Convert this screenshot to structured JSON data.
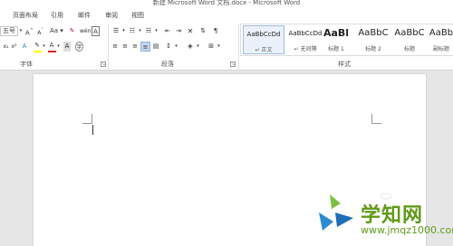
{
  "window": {
    "title": "新建 Microsoft Word 文档.docx - Microsoft Word"
  },
  "tabs": [
    "页面布局",
    "引用",
    "邮件",
    "审阅",
    "视图"
  ],
  "font_group": {
    "label": "字体",
    "font_size": "五号",
    "font_size_icon": "font-size-dropdown",
    "buttons": [
      "A",
      "A",
      "Aa",
      "A",
      "A"
    ]
  },
  "paragraph_group": {
    "label": "段落"
  },
  "styles_group": {
    "label": "样式",
    "items": [
      {
        "preview": "AaBbCcDd",
        "name": "↵ 正文",
        "selected": true
      },
      {
        "preview": "AaBbCcDd",
        "name": "↵ 无间隔",
        "selected": false
      },
      {
        "preview": "AaBl",
        "name": "标题 1",
        "selected": false
      },
      {
        "preview": "AaBbC",
        "name": "标题 2",
        "selected": false
      },
      {
        "preview": "AaBbC",
        "name": "标题",
        "selected": false
      },
      {
        "preview": "AaBb",
        "name": "副标题",
        "selected": false
      }
    ]
  },
  "watermark": {
    "text": "学知网",
    "url": "www.jmqz1000.com"
  },
  "colors": {
    "highlight": "#ffff00",
    "font_color": "#d7261e",
    "accent_blue": "#2b579a"
  }
}
